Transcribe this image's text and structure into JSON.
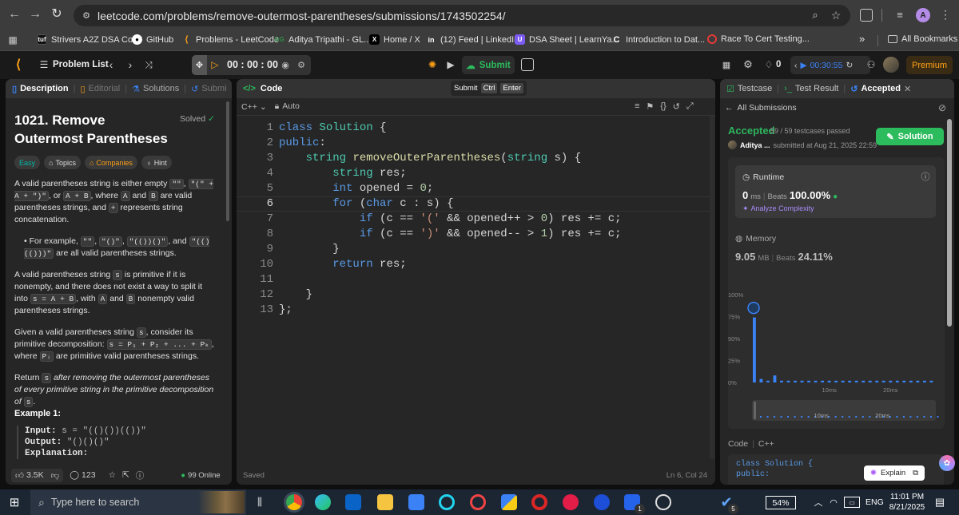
{
  "browser": {
    "url": "leetcode.com/problems/remove-outermost-parentheses/submissions/1743502254/",
    "profile_initial": "A",
    "bookmarks": [
      {
        "label": "Strivers A2Z DSA Co...",
        "icon": "tuf-icon"
      },
      {
        "label": "GitHub",
        "icon": "github-icon"
      },
      {
        "label": "Problems - LeetCode",
        "icon": "leetcode-icon"
      },
      {
        "label": "Aditya Tripathi - GL...",
        "icon": "gfg-icon"
      },
      {
        "label": "Home / X",
        "icon": "x-icon"
      },
      {
        "label": "(12) Feed | LinkedIn",
        "icon": "linkedin-icon"
      },
      {
        "label": "DSA Sheet | LearnYa...",
        "icon": "learnyard-icon"
      },
      {
        "label": "Introduction to Dat...",
        "icon": "codechef-icon"
      },
      {
        "label": "Race To Cert Testing...",
        "icon": "race-icon"
      }
    ],
    "more_bookmarks": "»",
    "all_bookmarks": "All Bookmarks"
  },
  "lcnav": {
    "problem_list": "Problem List",
    "timer": "00 : 00 : 00",
    "submit": "Submit",
    "streak": "0",
    "session_timer": "00:30:55",
    "premium": "Premium"
  },
  "left": {
    "tabs": {
      "description": "Description",
      "editorial": "Editorial",
      "solutions": "Solutions",
      "submissions": "Submi"
    },
    "title": "1021. Remove Outermost Parentheses",
    "solved": "Solved",
    "tags": {
      "difficulty": "Easy",
      "topics": "Topics",
      "companies": "Companies",
      "hint": "Hint"
    },
    "footer": {
      "likes": "3.5K",
      "comments": "123",
      "online": "99 Online"
    },
    "example_heading": "Example 1:",
    "example": {
      "input_label": "Input:",
      "input_value": "s = \"(()())(())\"",
      "output_label": "Output:",
      "output_value": "\"()()()\"",
      "explanation_label": "Explanation:"
    }
  },
  "editor": {
    "tab": "Code",
    "language": "C++",
    "mode": "Auto",
    "submit_tooltip": {
      "label": "Submit",
      "key1": "Ctrl",
      "key2": "Enter"
    },
    "status_left": "Saved",
    "status_right": "Ln 6, Col 24",
    "line_numbers": [
      "1",
      "2",
      "3",
      "4",
      "5",
      "6",
      "7",
      "8",
      "9",
      "10",
      "11",
      "12",
      "13"
    ]
  },
  "right": {
    "tabs": {
      "testcase": "Testcase",
      "result": "Test Result",
      "accepted": "Accepted"
    },
    "all_submissions": "All Submissions",
    "status": "Accepted",
    "testcases": "59 / 59 testcases passed",
    "user": "Aditya ...",
    "submitted": "submitted at Aug 21, 2025 22:59",
    "solution_button": "Solution",
    "runtime": {
      "label": "Runtime",
      "value": "0",
      "unit": "ms",
      "beats_label": "Beats",
      "beats": "100.00%",
      "analyze": "Analyze Complexity"
    },
    "memory": {
      "label": "Memory",
      "value": "9.05",
      "unit": "MB",
      "beats_label": "Beats",
      "beats": "24.11%"
    },
    "code_label": "Code",
    "code_lang": "C++",
    "code_preview": [
      "class Solution {",
      "public:"
    ],
    "explain": "Explain"
  },
  "chart_data": {
    "type": "bar",
    "y_ticks": [
      "100%",
      "75%",
      "50%",
      "25%",
      "0%"
    ],
    "x_ticks": [
      "10ms",
      "20ms"
    ],
    "ylim": [
      0,
      100
    ],
    "values": [
      74,
      4,
      2,
      8,
      2,
      2,
      2,
      2,
      2,
      2,
      2,
      2,
      2,
      2,
      2,
      2,
      2,
      2,
      2,
      2,
      2,
      2,
      2,
      2,
      2,
      2,
      2
    ],
    "highlight_index": 0,
    "colors": {
      "bar": "#3b82f6",
      "track": "#3b3b3b"
    }
  },
  "taskbar": {
    "search": "Type here to search",
    "battery": "54%",
    "lang": "ENG",
    "time": "11:01 PM",
    "date": "8/21/2025",
    "badge1": "1",
    "badge2": "5"
  },
  "colors": {
    "accent_green": "#2cbb5d",
    "accepted": "#2db55d",
    "premium": "#ffa116",
    "easy": "#00b8a3"
  }
}
